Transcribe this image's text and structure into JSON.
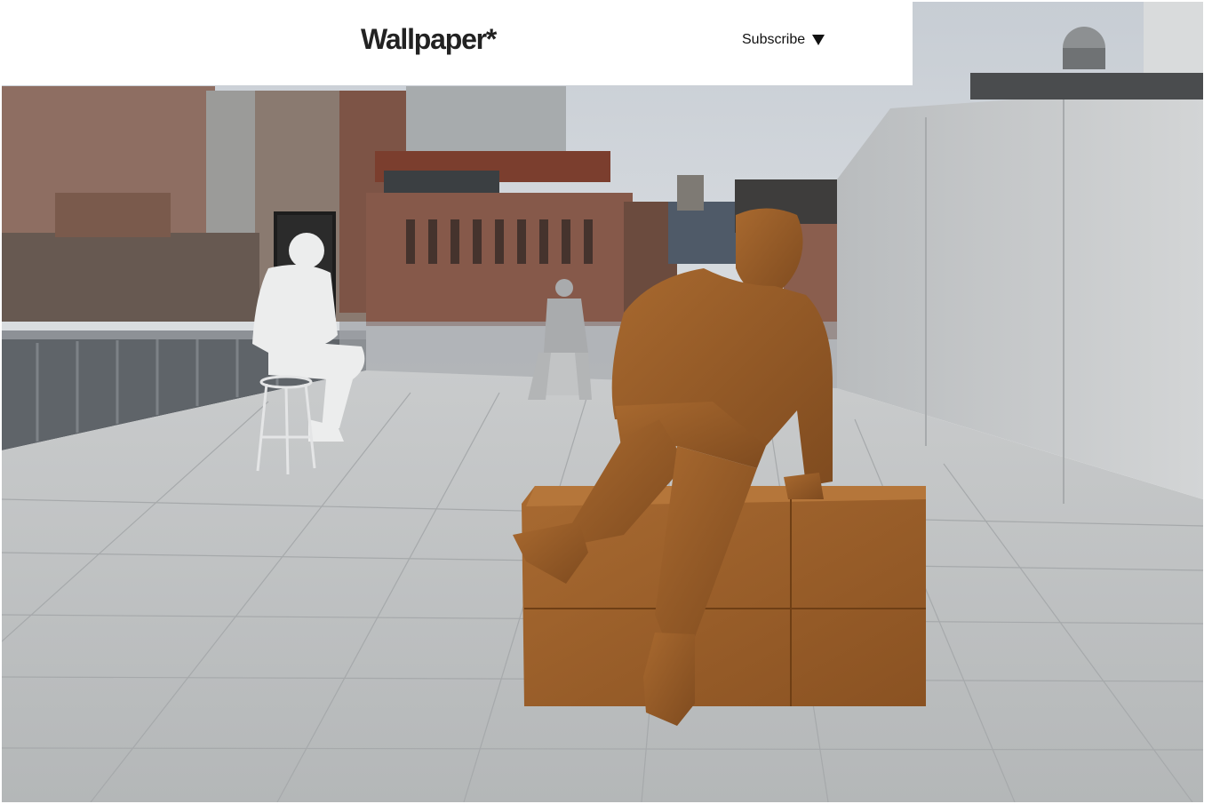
{
  "header": {
    "logo_text": "Wallpaper*",
    "subscribe_label": "Subscribe",
    "subscribe_icon": "caret-down-icon"
  },
  "hero": {
    "image_subject": "rooftop-sculptures-photo"
  },
  "colors": {
    "header_bg": "#ffffff",
    "logo": "#222222",
    "sky": "#cfd4d9",
    "terrace": "#bfc2c4",
    "bronze": "#9a5f2a",
    "rust_bench": "#a0612c"
  }
}
